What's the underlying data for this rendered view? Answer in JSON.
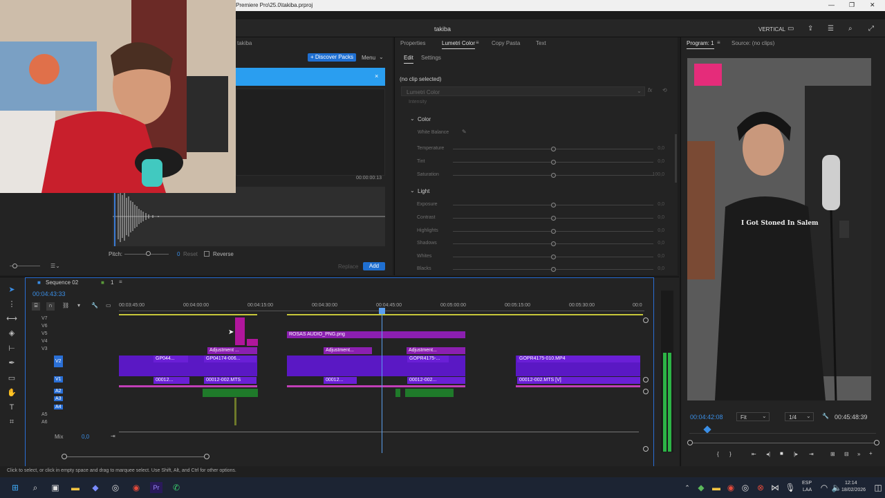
{
  "window": {
    "title": "Premiere Pro\\25.0\\takiba.prproj",
    "controls": [
      "—",
      "❐",
      "✕"
    ]
  },
  "workspace": {
    "project_title": "takiba",
    "mode_label": "VERTICAL"
  },
  "left_panel": {
    "tab_label": "takiba",
    "discover_label": "+ Discover Packs",
    "menu_label": "Menu",
    "timecode": "00:00:00:13",
    "pitch_label": "Pitch:",
    "pitch_value": "0",
    "reset_label": "Reset",
    "reverse_label": "Reverse",
    "replace_label": "Replace",
    "add_label": "Add"
  },
  "lumetri": {
    "tabs": [
      "Properties",
      "Lumetri Color",
      "Copy Pasta",
      "Text"
    ],
    "subtabs": [
      "Edit",
      "Settings"
    ],
    "no_clip": "(no clip selected)",
    "effect_select": "Lumetri Color",
    "intensity_label": "Intensity",
    "color_section": "Color",
    "white_balance": "White Balance",
    "light_section": "Light",
    "color_sliders": [
      {
        "label": "Temperature",
        "value": "0,0"
      },
      {
        "label": "Tint",
        "value": "0,0"
      },
      {
        "label": "Saturation",
        "value": "100,0"
      }
    ],
    "light_sliders": [
      {
        "label": "Exposure",
        "value": "0,0"
      },
      {
        "label": "Contrast",
        "value": "0,0"
      },
      {
        "label": "Highlights",
        "value": "0,0"
      },
      {
        "label": "Shadows",
        "value": "0,0"
      },
      {
        "label": "Whites",
        "value": "0,0"
      },
      {
        "label": "Blacks",
        "value": "0,0"
      }
    ]
  },
  "program_monitor": {
    "tabs": [
      "Program: 1",
      "Source: (no clips)"
    ],
    "current_time": "00:04:42:08",
    "fit_label": "Fit",
    "resolution_label": "1/4",
    "duration": "00:45:48:39",
    "video_caption": "I Got Stoned In Salem"
  },
  "timeline": {
    "sequence_name": "Sequence 02",
    "sequence_index": "1",
    "timecode": "00:04:43:33",
    "ruler": [
      "00:03:45:00",
      "00:04:00:00",
      "00:04:15:00",
      "00:04:30:00",
      "00:04:45:00",
      "00:05:00:00",
      "00:05:15:00",
      "00:05:30:00",
      "00:0"
    ],
    "video_tracks": [
      "V7",
      "V6",
      "V5",
      "V4",
      "V3",
      "V2",
      "V1"
    ],
    "audio_tracks": [
      "A2",
      "A3",
      "A4",
      "A5",
      "A6"
    ],
    "mix_label": "Mix",
    "mix_value": "0,0",
    "clips": {
      "rosas": "ROSAS AUDIO_PNG.png",
      "adj1": "Adjustment ...",
      "adj2": "Adjustment...",
      "adj3": "Adjustment...",
      "gp1": "GP044...",
      "gp2": "GP04174-006...",
      "gp3": "GOPR4175-...",
      "gp4": "GOPR4175-010.MP4",
      "a1": "00012...",
      "a2": "00012-002.MTS",
      "a3": "00012...",
      "a4": "00012-002...",
      "a5": "00012-002.MTS [V]"
    }
  },
  "status_bar": {
    "text": "Click to select, or click in empty space and drag to marquee select. Use Shift, Alt, and Ctrl for other options."
  },
  "taskbar": {
    "lang": "ESP",
    "layout": "LAA",
    "time": "12:14",
    "date": "18/02/2026"
  }
}
